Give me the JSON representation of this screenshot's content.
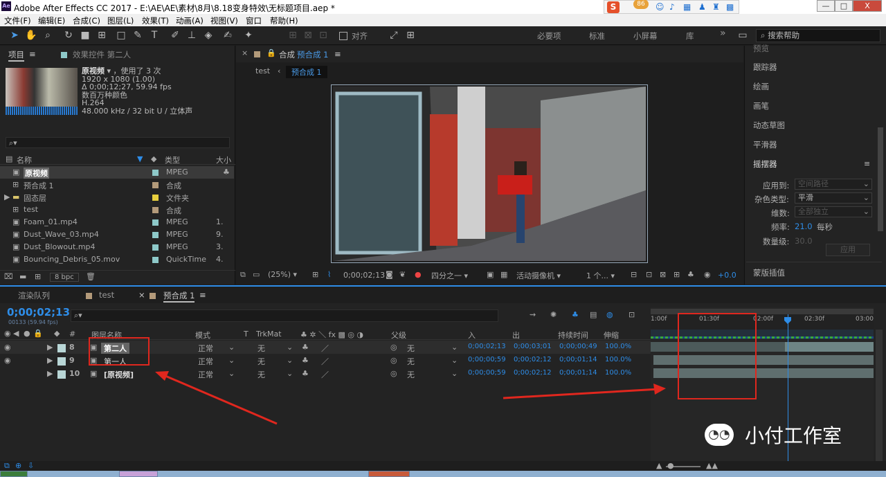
{
  "window": {
    "title": "Adobe After Effects CC 2017 - E:\\AE\\AE\\素材\\8月\\8.18变身特效\\无标题项目.aep *",
    "logo": "Ae",
    "ime_badge": "86",
    "min": "—",
    "restore": "□",
    "close": "X"
  },
  "menu": [
    "文件(F)",
    "编辑(E)",
    "合成(C)",
    "图层(L)",
    "效果(T)",
    "动画(A)",
    "视图(V)",
    "窗口",
    "帮助(H)"
  ],
  "toolbar": {
    "align_label": "对齐",
    "workspaces": [
      "必要项",
      "标准",
      "小屏幕",
      "库"
    ],
    "more": "»",
    "search_placeholder": "搜索帮助"
  },
  "project": {
    "tab_label": "项目",
    "tab_menu": "≡",
    "effects_tab": "效果控件 第二人",
    "asset": {
      "name": "原视频",
      "usage": "，使用了 3 次",
      "resolution": "1920 x 1080 (1.00)",
      "duration": "Δ 0;00;12;27, 59.94 fps",
      "colors": "数百万种颜色",
      "codec": "H.264",
      "audio": "48.000 kHz / 32 bit U / 立体声"
    },
    "search_icon": "⌕▾",
    "columns": [
      "名称",
      "类型",
      "大小"
    ],
    "items": [
      {
        "name": "原视频",
        "type": "MPEG",
        "size": "",
        "color": "#8ec9c9"
      },
      {
        "name": "预合成 1",
        "type": "合成",
        "size": "",
        "color": "#b39a7a"
      },
      {
        "name": "固态层",
        "type": "文件夹",
        "size": "",
        "color": "#e8cf3e"
      },
      {
        "name": "test",
        "type": "合成",
        "size": "",
        "color": "#b39a7a"
      },
      {
        "name": "Foam_01.mp4",
        "type": "MPEG",
        "size": "1.",
        "color": "#8ec9c9"
      },
      {
        "name": "Dust_Wave_03.mp4",
        "type": "MPEG",
        "size": "9.",
        "color": "#8ec9c9"
      },
      {
        "name": "Dust_Blowout.mp4",
        "type": "MPEG",
        "size": "3.",
        "color": "#8ec9c9"
      },
      {
        "name": "Bouncing_Debris_05.mov",
        "type": "QuickTime",
        "size": "4.",
        "color": "#8ec9c9"
      }
    ],
    "bpc": "8 bpc"
  },
  "composition": {
    "panel_title": "合成",
    "panel_name": "预合成 1",
    "breadcrumb": [
      "test",
      "预合成 1"
    ],
    "zoom": "(25%)",
    "timecode": "0;00;02;13",
    "resolution": "四分之一",
    "camera": "活动摄像机",
    "views": "1 个...",
    "exposure": "+0.0"
  },
  "right_panel": {
    "items": [
      "预览",
      "跟踪器",
      "绘画",
      "画笔",
      "动态草图",
      "平滑器"
    ],
    "wiggler": {
      "title": "摇摆器",
      "apply_to_label": "应用到:",
      "apply_to_value": "空间路径",
      "noise_label": "杂色类型:",
      "noise_value": "平滑",
      "dim_label": "维数:",
      "dim_value": "全部独立",
      "freq_label": "频率:",
      "freq_value": "21.0",
      "freq_unit": "每秒",
      "mag_label": "数量级:",
      "mag_value": "30.0",
      "apply_btn": "应用"
    },
    "mask_interp": "蒙版插值"
  },
  "timeline": {
    "tabs": [
      "渲染队列",
      "test",
      "预合成 1"
    ],
    "tab_close": "×",
    "timecode": "0;00;02;13",
    "fps": "00133 (59.94 fps)",
    "search_icon": "⌕▾",
    "columns": {
      "num": "#",
      "name": "图层名称",
      "mode": "模式",
      "t": "T",
      "trkmat": "TrkMat",
      "parent": "父级",
      "in": "入",
      "out": "出",
      "dur": "持续时间",
      "stretch": "伸缩"
    },
    "layers": [
      {
        "num": "8",
        "name": "第二人",
        "mode": "正常",
        "trkmat": "无",
        "parent": "无",
        "in": "0;00;02;13",
        "out": "0;00;03;01",
        "dur": "0;00;00;49",
        "stretch": "100.0%"
      },
      {
        "num": "9",
        "name": "第一人",
        "mode": "正常",
        "trkmat": "无",
        "parent": "无",
        "in": "0;00;00;59",
        "out": "0;00;02;12",
        "dur": "0;00;01;14",
        "stretch": "100.0%"
      },
      {
        "num": "10",
        "name": "[原视频]",
        "mode": "正常",
        "trkmat": "无",
        "parent": "无",
        "in": "0;00;00;59",
        "out": "0;00;02;12",
        "dur": "0;00;01;14",
        "stretch": "100.0%"
      }
    ],
    "ruler": [
      "1:00f",
      "01:30f",
      "02:00f",
      "02:30f",
      "03:00"
    ],
    "current_time_fraction": 0.615
  },
  "watermark": "小付工作室",
  "colors": {
    "accent_blue": "#2e8de8",
    "annotation_red": "#e0271e",
    "panel_bg": "#232323",
    "comp_bg": "#1a1a1a"
  }
}
